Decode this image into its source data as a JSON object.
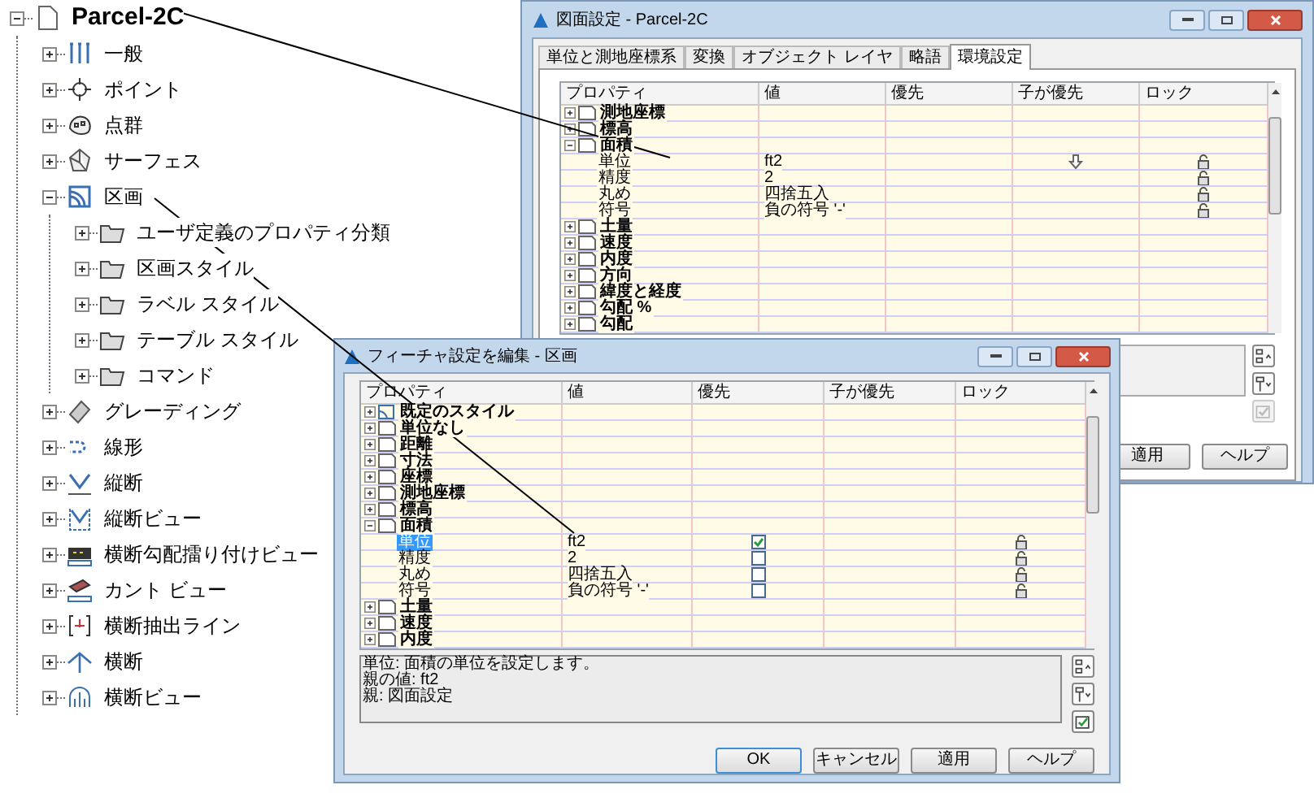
{
  "tree": {
    "label": "Parcel-2C",
    "kind": "drawing",
    "expanded": true,
    "children": [
      {
        "label": "一般",
        "kind": "general",
        "expanded": false
      },
      {
        "label": "ポイント",
        "kind": "point",
        "expanded": false
      },
      {
        "label": "点群",
        "kind": "point-group",
        "expanded": false
      },
      {
        "label": "サーフェス",
        "kind": "surface",
        "expanded": false
      },
      {
        "label": "区画",
        "kind": "parcel",
        "expanded": true,
        "children": [
          {
            "label": "ユーザ定義のプロパティ分類",
            "kind": "folder",
            "expanded": false
          },
          {
            "label": "区画スタイル",
            "kind": "folder",
            "expanded": false
          },
          {
            "label": "ラベル スタイル",
            "kind": "folder",
            "expanded": false
          },
          {
            "label": "テーブル スタイル",
            "kind": "folder",
            "expanded": false
          },
          {
            "label": "コマンド",
            "kind": "folder",
            "expanded": false
          }
        ]
      },
      {
        "label": "グレーディング",
        "kind": "grading",
        "expanded": false
      },
      {
        "label": "線形",
        "kind": "alignment",
        "expanded": false
      },
      {
        "label": "縦断",
        "kind": "profile",
        "expanded": false
      },
      {
        "label": "縦断ビュー",
        "kind": "profile-view",
        "expanded": false
      },
      {
        "label": "横断勾配擂り付けビュー",
        "kind": "superelevation-view",
        "expanded": false
      },
      {
        "label": "カント ビュー",
        "kind": "cant-view",
        "expanded": false
      },
      {
        "label": "横断抽出ライン",
        "kind": "sample-line",
        "expanded": false
      },
      {
        "label": "横断",
        "kind": "section",
        "expanded": false
      },
      {
        "label": "横断ビュー",
        "kind": "section-view",
        "expanded": false
      }
    ]
  },
  "top_dialog": {
    "title": "図面設定 - Parcel-2C",
    "tabs": [
      {
        "label": "単位と測地座標系",
        "selected": false
      },
      {
        "label": "変換",
        "selected": false
      },
      {
        "label": "オブジェクト レイヤ",
        "selected": false
      },
      {
        "label": "略語",
        "selected": false
      },
      {
        "label": "環境設定",
        "selected": true
      }
    ],
    "columns": [
      "プロパティ",
      "値",
      "優先",
      "子が優先",
      "ロック"
    ],
    "rows": [
      {
        "kind": "category",
        "label": "測地座標",
        "expanded": false
      },
      {
        "kind": "category",
        "label": "標高",
        "expanded": false
      },
      {
        "kind": "category",
        "label": "面積",
        "expanded": true
      },
      {
        "kind": "property",
        "label": "単位",
        "value": "ft2",
        "child_override": true
      },
      {
        "kind": "property",
        "label": "精度",
        "value": "2",
        "child_override": false
      },
      {
        "kind": "property",
        "label": "丸め",
        "value": "四捨五入",
        "child_override": false
      },
      {
        "kind": "property",
        "label": "符号",
        "value": "負の符号 '-'",
        "child_override": false
      },
      {
        "kind": "category",
        "label": "土量",
        "expanded": false
      },
      {
        "kind": "category",
        "label": "速度",
        "expanded": false
      },
      {
        "kind": "category",
        "label": "内度",
        "expanded": false
      },
      {
        "kind": "category",
        "label": "方向",
        "expanded": false
      },
      {
        "kind": "category",
        "label": "緯度と経度",
        "expanded": false
      },
      {
        "kind": "category",
        "label": "勾配 %",
        "expanded": false
      },
      {
        "kind": "category",
        "label": "勾配",
        "expanded": false
      }
    ],
    "tools": [
      {
        "kind": "sort-up",
        "disabled": false
      },
      {
        "kind": "sort-down",
        "disabled": false
      },
      {
        "kind": "apply-check",
        "disabled": true
      }
    ],
    "buttons": [
      {
        "label": "適用",
        "default": false
      },
      {
        "label": "ヘルプ",
        "default": false
      }
    ]
  },
  "bottom_dialog": {
    "title": "フィーチャ設定を編集 - 区画",
    "columns": [
      "プロパティ",
      "値",
      "優先",
      "子が優先",
      "ロック"
    ],
    "rows": [
      {
        "kind": "style",
        "label": "既定のスタイル",
        "expanded": false
      },
      {
        "kind": "category",
        "label": "単位なし",
        "expanded": false
      },
      {
        "kind": "category",
        "label": "距離",
        "expanded": false
      },
      {
        "kind": "category",
        "label": "寸法",
        "expanded": false
      },
      {
        "kind": "category",
        "label": "座標",
        "expanded": false
      },
      {
        "kind": "category",
        "label": "測地座標",
        "expanded": false
      },
      {
        "kind": "category",
        "label": "標高",
        "expanded": false
      },
      {
        "kind": "category",
        "label": "面積",
        "expanded": true
      },
      {
        "kind": "property",
        "label": "単位",
        "value": "ft2",
        "override": true,
        "selected": true
      },
      {
        "kind": "property",
        "label": "精度",
        "value": "2",
        "override": false,
        "selected": false
      },
      {
        "kind": "property",
        "label": "丸め",
        "value": "四捨五入",
        "override": false,
        "selected": false
      },
      {
        "kind": "property",
        "label": "符号",
        "value": "負の符号 '-'",
        "override": false,
        "selected": false
      },
      {
        "kind": "category",
        "label": "土量",
        "expanded": false
      },
      {
        "kind": "category",
        "label": "速度",
        "expanded": false
      },
      {
        "kind": "category",
        "label": "内度",
        "expanded": false
      }
    ],
    "description": [
      "単位: 面積の単位を設定します。",
      "親の値: ft2",
      "親: 図面設定"
    ],
    "tools": [
      {
        "kind": "sort-up",
        "disabled": false
      },
      {
        "kind": "sort-down",
        "disabled": false
      },
      {
        "kind": "apply-check",
        "disabled": false
      }
    ],
    "buttons": [
      {
        "label": "OK",
        "default": true
      },
      {
        "label": "キャンセル",
        "default": false
      },
      {
        "label": "適用",
        "default": false
      },
      {
        "label": "ヘルプ",
        "default": false
      }
    ]
  }
}
